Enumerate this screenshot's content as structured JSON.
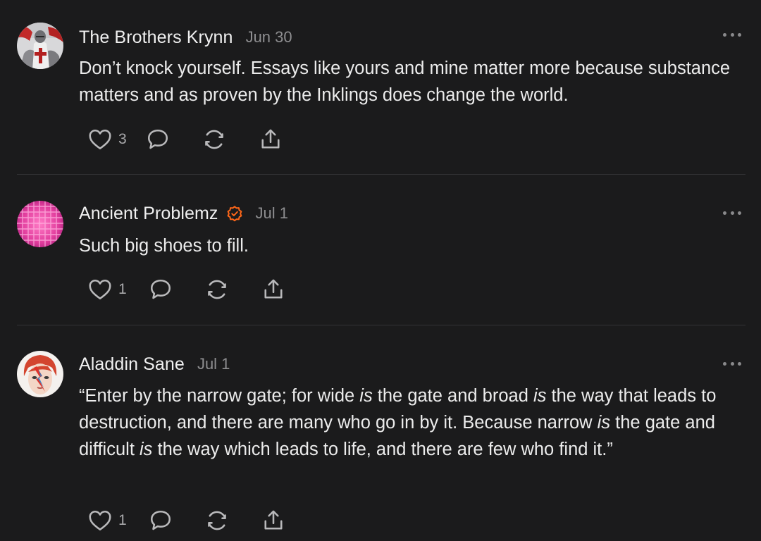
{
  "comments": [
    {
      "author": "The Brothers Krynn",
      "date": "Jun 30",
      "verified": false,
      "avatar": "knight-avatar",
      "text": "Don’t knock yourself. Essays like yours and mine matter more because substance matters and as proven by the Inklings does change the world.",
      "likes": "3"
    },
    {
      "author": "Ancient Problemz",
      "date": "Jul 1",
      "verified": true,
      "avatar": "pink-grid-avatar",
      "text": "Such big shoes to fill.",
      "likes": "1"
    },
    {
      "author": "Aladdin Sane",
      "date": "Jul 1",
      "verified": false,
      "avatar": "bowie-avatar",
      "text_parts": [
        "“Enter by the narrow gate; for wide ",
        "is",
        " the gate and broad ",
        "is",
        " the way that leads to destruction, and there are many who go in by it. Because narrow ",
        "is",
        " the gate and difficult ",
        "is",
        " the way which leads to life, and there are few who find it.”"
      ],
      "likes": "1"
    }
  ],
  "colors": {
    "background": "#1b1b1c",
    "verified_badge": "#ff6719",
    "secondary_text": "#8e8e90",
    "divider": "#333335"
  },
  "icons": {
    "like": "heart-icon",
    "reply": "comment-bubble-icon",
    "restack": "restack-icon",
    "share": "share-icon",
    "more": "more-options-icon",
    "verified": "verified-check-icon"
  }
}
